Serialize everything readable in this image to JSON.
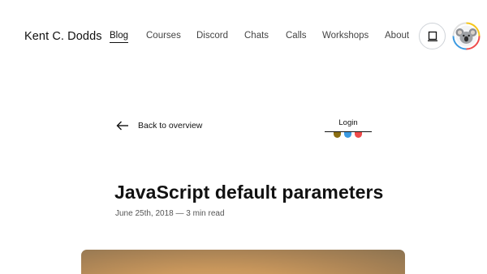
{
  "header": {
    "brand": "Kent C. Dodds",
    "nav": [
      {
        "label": "Blog",
        "active": true
      },
      {
        "label": "Courses"
      },
      {
        "label": "Discord"
      },
      {
        "label": "Chats"
      },
      {
        "label": "Calls"
      },
      {
        "label": "Workshops"
      },
      {
        "label": "About"
      }
    ],
    "theme_icon": "laptop-icon",
    "avatar_icon": "koala-avatar-icon"
  },
  "back": {
    "label": "Back to overview",
    "icon": "arrow-left-icon"
  },
  "login": {
    "label": "Login",
    "team_colors": [
      "#8a6d12",
      "#3b9ae1",
      "#ef4b4b"
    ]
  },
  "post": {
    "title": "JavaScript default parameters",
    "meta": "June 25th, 2018 — 3 min read"
  }
}
